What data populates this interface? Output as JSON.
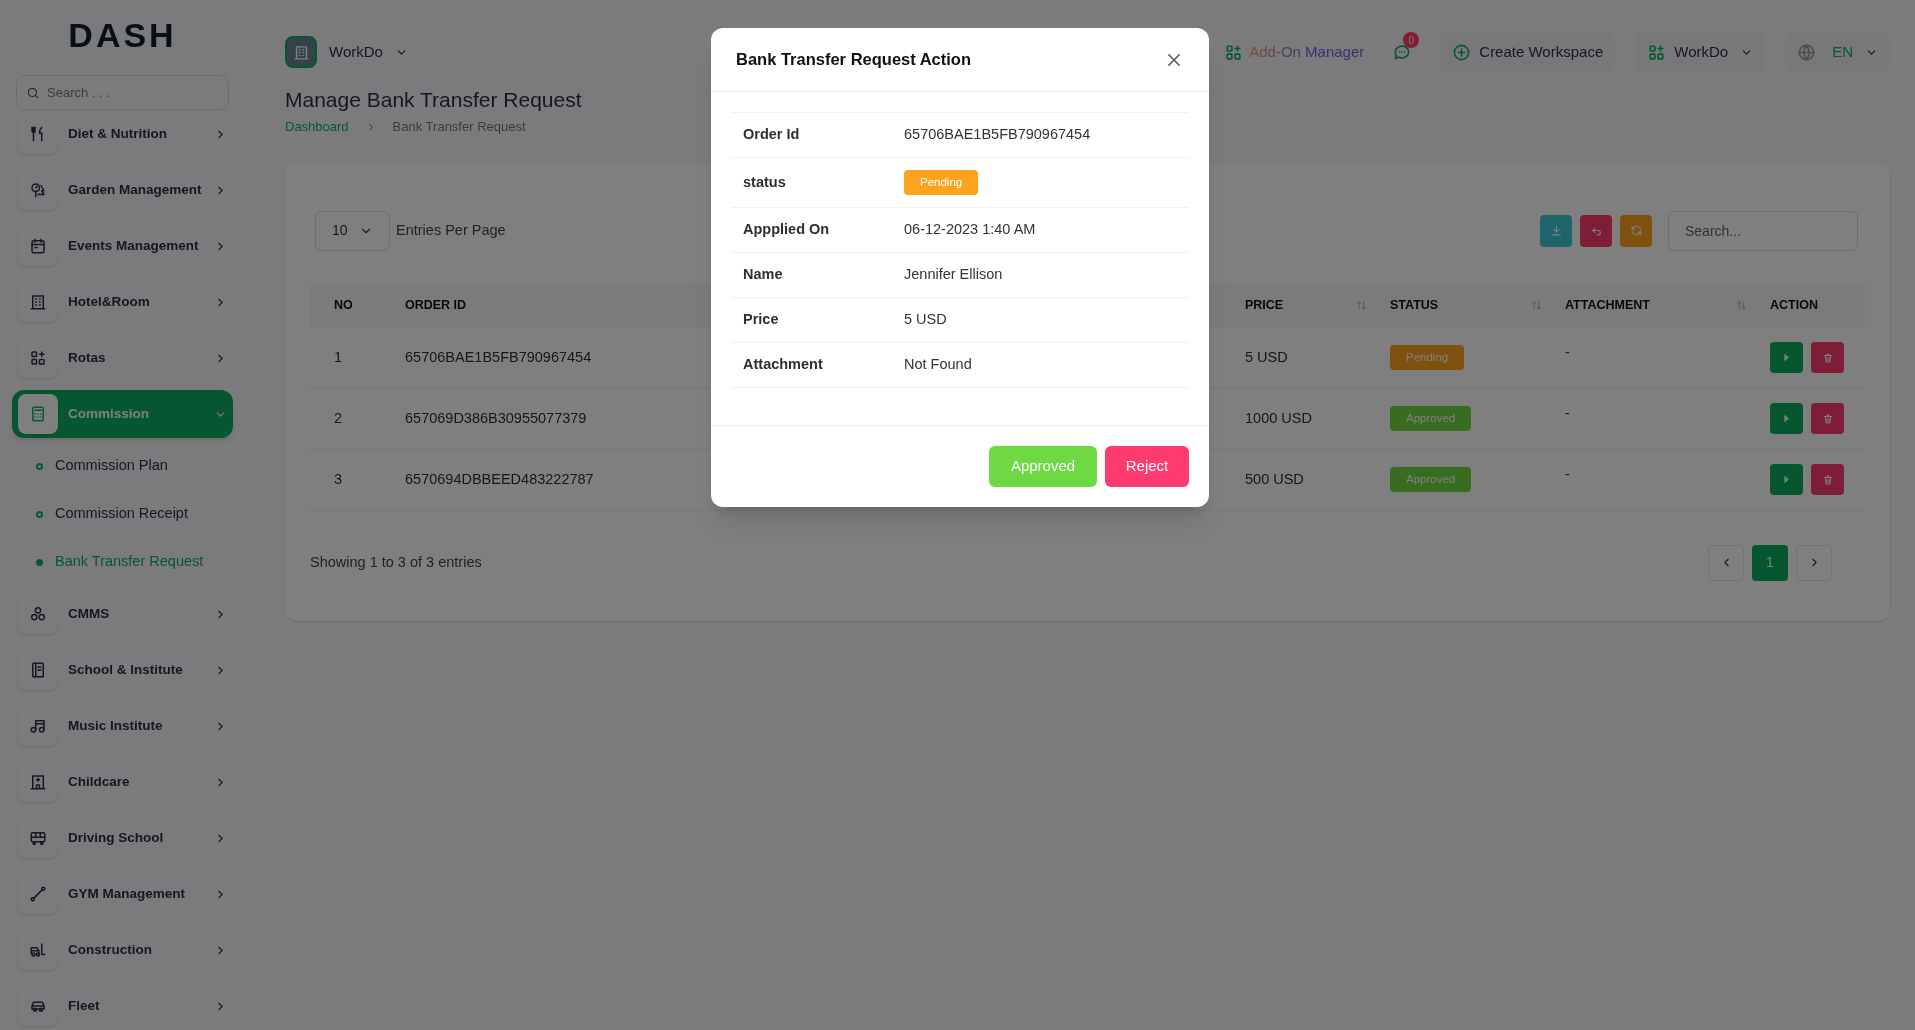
{
  "sidebar": {
    "logo": "DASH",
    "search_placeholder": "Search . . .",
    "items": [
      {
        "label": "Diet & Nutrition",
        "selected": false,
        "expanded": false
      },
      {
        "label": "Garden Management",
        "selected": false,
        "expanded": false
      },
      {
        "label": "Events Management",
        "selected": false,
        "expanded": false
      },
      {
        "label": "Hotel&Room",
        "selected": false,
        "expanded": false
      },
      {
        "label": "Rotas",
        "selected": false,
        "expanded": false
      },
      {
        "label": "Commission",
        "selected": true,
        "expanded": true,
        "children": [
          {
            "label": "Commission Plan",
            "selected": false
          },
          {
            "label": "Commission Receipt",
            "selected": false
          },
          {
            "label": "Bank Transfer Request",
            "selected": true
          }
        ]
      },
      {
        "label": "CMMS",
        "selected": false,
        "expanded": false
      },
      {
        "label": "School & Institute",
        "selected": false,
        "expanded": false
      },
      {
        "label": "Music Institute",
        "selected": false,
        "expanded": false
      },
      {
        "label": "Childcare",
        "selected": false,
        "expanded": false
      },
      {
        "label": "Driving School",
        "selected": false,
        "expanded": false
      },
      {
        "label": "GYM Management",
        "selected": false,
        "expanded": false
      },
      {
        "label": "Construction",
        "selected": false,
        "expanded": false
      },
      {
        "label": "Fleet",
        "selected": false,
        "expanded": false
      }
    ]
  },
  "header": {
    "workspace": "WorkDo",
    "addon_manager": "Add-On Manager",
    "message_count": "0",
    "create_workspace": "Create Workspace",
    "workspace_menu": "WorkDo",
    "language": "EN"
  },
  "page": {
    "title": "Manage Bank Transfer Request",
    "breadcrumb": [
      "Dashboard",
      "Bank Transfer Request"
    ]
  },
  "table": {
    "entries_per_page": "10",
    "entries_label": "Entries Per Page",
    "search_placeholder": "Search...",
    "columns": [
      {
        "label": "NO",
        "sortable": false
      },
      {
        "label": "ORDER ID",
        "sortable": false
      },
      {
        "label": "PRICE",
        "sortable": true
      },
      {
        "label": "STATUS",
        "sortable": true
      },
      {
        "label": "ATTACHMENT",
        "sortable": true
      },
      {
        "label": "ACTION",
        "sortable": false
      }
    ],
    "rows": [
      {
        "no": "1",
        "order_id": "65706BAE1B5FB790967454",
        "price": "5 USD",
        "status": {
          "label": "Pending",
          "kind": "pending"
        },
        "attachment": "-"
      },
      {
        "no": "2",
        "order_id": "657069D386B30955077379",
        "price": "1000 USD",
        "status": {
          "label": "Approved",
          "kind": "approved"
        },
        "attachment": "-"
      },
      {
        "no": "3",
        "order_id": "6570694DBBEED483222787",
        "price": "500 USD",
        "status": {
          "label": "Approved",
          "kind": "approved"
        },
        "attachment": "-"
      }
    ],
    "summary": "Showing 1 to 3 of 3 entries",
    "pages": [
      {
        "label": "1",
        "selected": true
      }
    ]
  },
  "modal": {
    "title": "Bank Transfer Request Action",
    "rows": [
      {
        "label": "Order Id",
        "value": "65706BAE1B5FB790967454",
        "kind": "text"
      },
      {
        "label": "status",
        "value": "Pending",
        "kind": "pending"
      },
      {
        "label": "Appplied On",
        "value": "06-12-2023 1:40 AM",
        "kind": "text"
      },
      {
        "label": "Name",
        "value": "Jennifer Ellison",
        "kind": "text"
      },
      {
        "label": "Price",
        "value": "5 USD",
        "kind": "text"
      },
      {
        "label": "Attachment",
        "value": "Not Found",
        "kind": "text"
      }
    ],
    "buttons": [
      {
        "label": "Approved",
        "kind": "approve"
      },
      {
        "label": "Reject",
        "kind": "reject"
      }
    ]
  }
}
